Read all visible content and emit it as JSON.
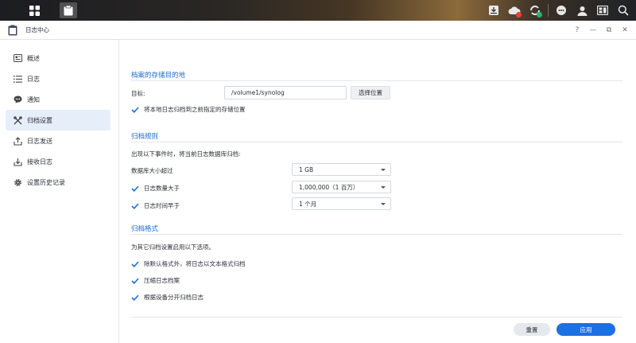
{
  "window": {
    "title": "日志中心",
    "controls": [
      "?",
      "—",
      "⧉",
      "✕"
    ]
  },
  "sidebar": {
    "items": [
      {
        "label": "概述",
        "icon": "overview-icon"
      },
      {
        "label": "日志",
        "icon": "list-icon"
      },
      {
        "label": "通知",
        "icon": "chat-bubble-icon"
      },
      {
        "label": "归档设置",
        "icon": "tools-icon",
        "active": true
      },
      {
        "label": "日志发送",
        "icon": "send-icon"
      },
      {
        "label": "接收日志",
        "icon": "receive-icon"
      },
      {
        "label": "设置历史记录",
        "icon": "gear-icon"
      }
    ]
  },
  "destination": {
    "title": "档案的存储目的地",
    "target_label": "目标:",
    "target_value": "/volume1/synolog",
    "choose_button": "选择位置",
    "archive_previous_label": "将本地日志归档到之前指定的存储位置",
    "archive_previous_checked": true
  },
  "rules": {
    "title": "归档规则",
    "intro": "出现以下事件时，将当前日志数据库归档:",
    "db_size_label": "数据库大小超过",
    "db_size_value": "1 GB",
    "count_label": "日志数量大于",
    "count_checked": true,
    "count_value": "1,000,000（1 百万）",
    "time_label": "日志时间早于",
    "time_checked": true,
    "time_value": "1 个月"
  },
  "format": {
    "title": "归档格式",
    "intro": "为其它归档设置启用以下选项。",
    "option1": "除默认格式外，将日志以文本格式归档",
    "option2": "压缩日志档案",
    "option3": "根据设备分开归档日志",
    "all_checked": true
  },
  "footer": {
    "reset": "重置",
    "apply": "应用"
  },
  "colors": {
    "accent": "#1b70e3",
    "section_title": "#1f6ad0"
  }
}
